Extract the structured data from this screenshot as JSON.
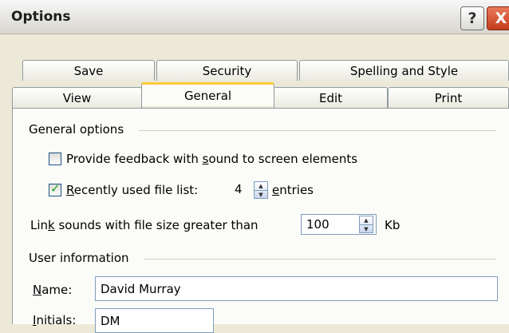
{
  "window": {
    "title": "Options",
    "help_glyph": "?",
    "close_glyph": "X"
  },
  "tabs": {
    "back_row": [
      "Save",
      "Security",
      "Spelling and Style"
    ],
    "front_row": [
      "View",
      "General",
      "Edit",
      "Print"
    ],
    "selected": "General"
  },
  "general_options": {
    "group_label": "General options",
    "feedback_checkbox": {
      "label_pre": "Provide feedback with ",
      "label_hotkey": "s",
      "label_post": "ound to screen elements",
      "checked": false
    },
    "recent_files": {
      "label_hotkey": "R",
      "label_post": "ecently used file list:",
      "checked": true,
      "value": "4",
      "suffix_hotkey": "e",
      "suffix_post": "ntries"
    },
    "link_sounds": {
      "label_pre": "Lin",
      "label_hotkey": "k",
      "label_post": " sounds with file size greater than",
      "value": "100",
      "unit": "Kb"
    }
  },
  "user_info": {
    "group_label": "User information",
    "name": {
      "label_hotkey": "N",
      "label_post": "ame:",
      "value": "David Murray"
    },
    "initials": {
      "label_hotkey": "I",
      "label_post": "nitials:",
      "value": "DM"
    }
  },
  "icons": {
    "spin_up": "▲",
    "spin_down": "▼",
    "check": "✓"
  }
}
